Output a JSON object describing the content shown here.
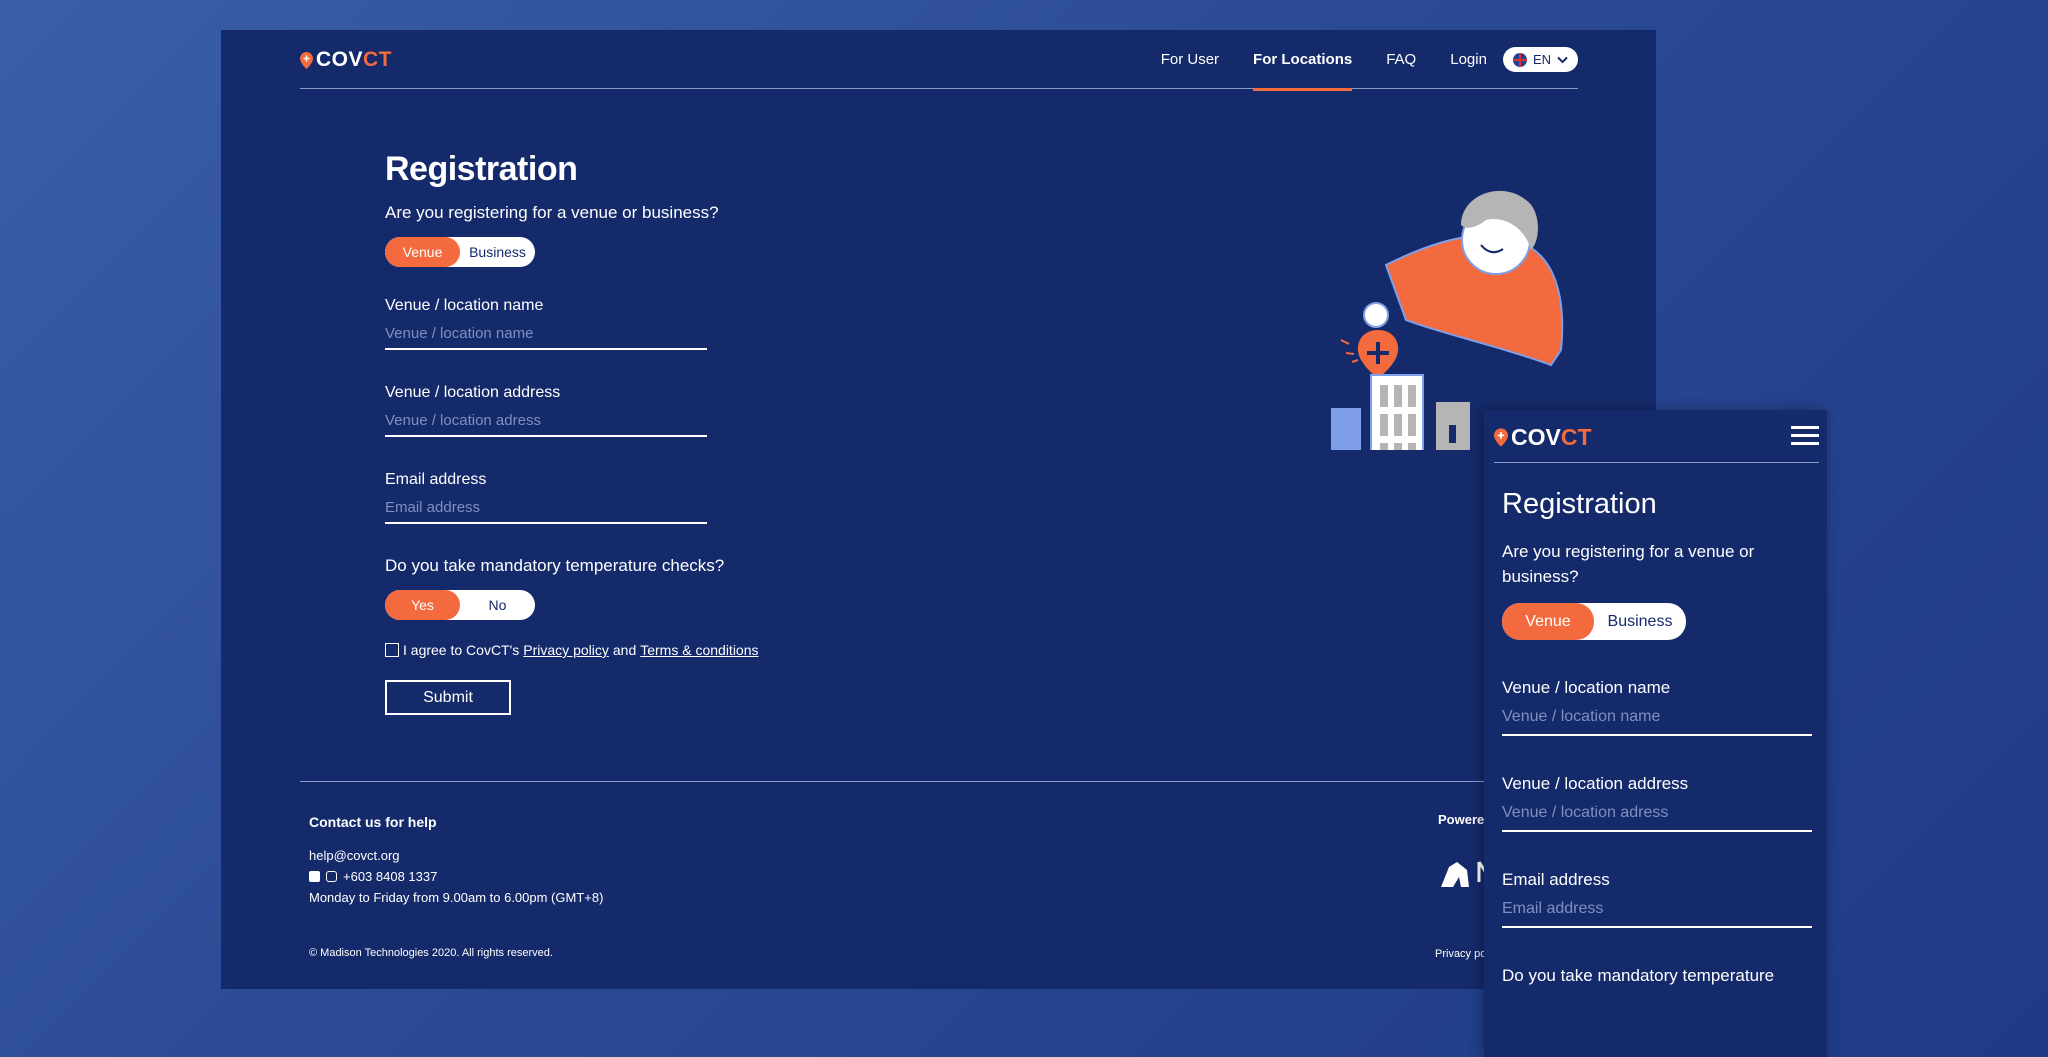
{
  "brand": {
    "logo_part1": "COV",
    "logo_part2": "CT",
    "accent": "#f26a3d",
    "bg": "#152a6b"
  },
  "nav": {
    "items": [
      "For User",
      "For Locations",
      "FAQ",
      "Login"
    ],
    "active": "For Locations",
    "language": "EN"
  },
  "form": {
    "title": "Registration",
    "type_question": "Are you registering for a venue or business?",
    "type_options": [
      "Venue",
      "Business"
    ],
    "type_selected": "Venue",
    "name_label": "Venue / location name",
    "name_placeholder": "Venue / location name",
    "address_label": "Venue / location address",
    "address_placeholder": "Venue / location adress",
    "email_label": "Email address",
    "email_placeholder": "Email address",
    "temp_question": "Do you take mandatory temperature checks?",
    "temp_options": [
      "Yes",
      "No"
    ],
    "temp_selected": "Yes",
    "agree_prefix": "I agree to CovCT's",
    "privacy_link": "Privacy policy",
    "and_text": "and",
    "terms_link": "Terms & conditions",
    "submit_label": "Submit"
  },
  "footer": {
    "contact_heading": "Contact us for help",
    "email": "help@covct.org",
    "phone": "+603 8408 1337",
    "hours": "Monday to Friday from 9.00am to 6.00pm (GMT+8)",
    "copyright": "© Madison Technologies 2020. All rights reserved.",
    "powered_by": "Powered by",
    "privacy_policy": "Privacy policy ·"
  },
  "mobile": {
    "title": "Registration",
    "type_question": "Are you registering for a venue or business?",
    "type_options": [
      "Venue",
      "Business"
    ],
    "name_label": "Venue / location name",
    "name_placeholder": "Venue / location name",
    "address_label": "Venue / location address",
    "address_placeholder": "Venue / location adress",
    "email_label": "Email address",
    "email_placeholder": "Email address",
    "temp_question_partial": "Do you take mandatory temperature"
  }
}
